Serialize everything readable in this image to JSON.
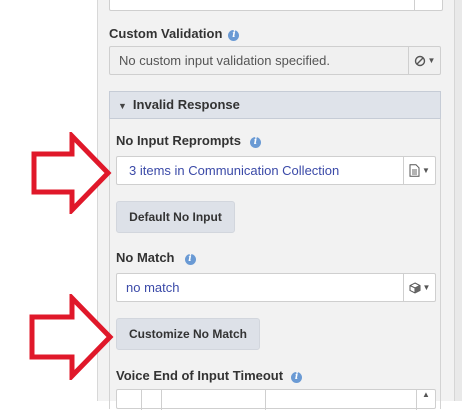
{
  "custom_validation": {
    "label": "Custom Validation",
    "value": "No custom input validation specified."
  },
  "invalid_response": {
    "header": "Invalid Response",
    "no_input_reprompts": {
      "label": "No Input Reprompts",
      "value": "3 items in Communication Collection",
      "button": "Default No Input"
    },
    "no_match": {
      "label": "No Match",
      "value": "no match",
      "button": "Customize No Match"
    },
    "voice_timeout": {
      "label": "Voice End of Input Timeout"
    }
  },
  "colors": {
    "arrow": "#e0182a",
    "info_icon": "#6a9ad4",
    "link_text": "#3b4aa8"
  }
}
